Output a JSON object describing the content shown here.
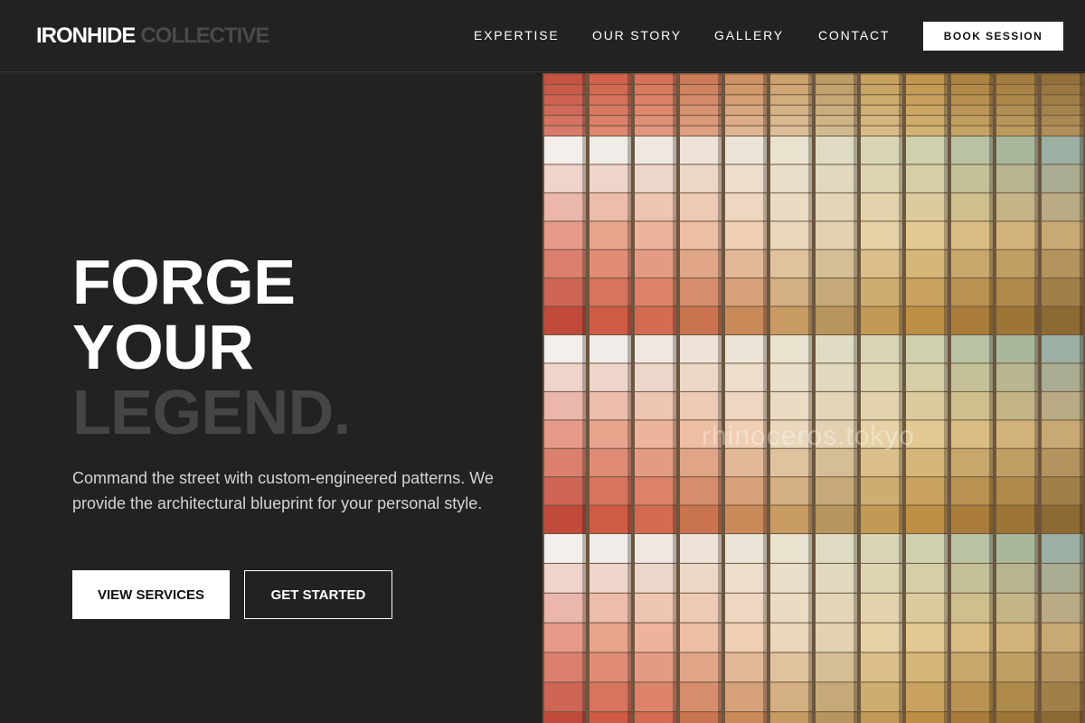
{
  "brand": {
    "name_main": "IRONHIDE",
    "name_secondary": "COLLECTIVE"
  },
  "nav": {
    "items": [
      {
        "label": "EXPERTISE"
      },
      {
        "label": "OUR STORY"
      },
      {
        "label": "GALLERY"
      },
      {
        "label": "CONTACT"
      }
    ],
    "cta_label": "BOOK SESSION"
  },
  "hero": {
    "title_line1": "FORGE",
    "title_line2": "YOUR",
    "title_line3": "LEGEND.",
    "subtitle": "Command the street with custom-engineered patterns. We provide the architectural blueprint for your personal style.",
    "primary_button": "VIEW SERVICES",
    "secondary_button": "GET STARTED"
  },
  "photo": {
    "watermark": "rhinoceros.tokyo",
    "column_palettes": [
      [
        "#c24a3a",
        "#e79a8a",
        "#f4efec"
      ],
      [
        "#cf5b44",
        "#e9a48e",
        "#f2ece8"
      ],
      [
        "#d46b50",
        "#edb39c",
        "#efe7e1"
      ],
      [
        "#c9744f",
        "#ecbea3",
        "#eee3d8"
      ],
      [
        "#c98a5a",
        "#efcfb5",
        "#ece4d6"
      ],
      [
        "#c89b63",
        "#ead7bd",
        "#e9e2cf"
      ],
      [
        "#b8955c",
        "#e3d2b2",
        "#dfdcc3"
      ],
      [
        "#c29a55",
        "#e6d2a6",
        "#d9d6b8"
      ],
      [
        "#bd8f45",
        "#e2c993",
        "#cfd0b0"
      ],
      [
        "#a97c3a",
        "#d9bd82",
        "#b9c3a4"
      ],
      [
        "#9d7537",
        "#d2b47a",
        "#a9b79d"
      ],
      [
        "#8e6a33",
        "#c8a873",
        "#9bb0a2"
      ]
    ]
  }
}
